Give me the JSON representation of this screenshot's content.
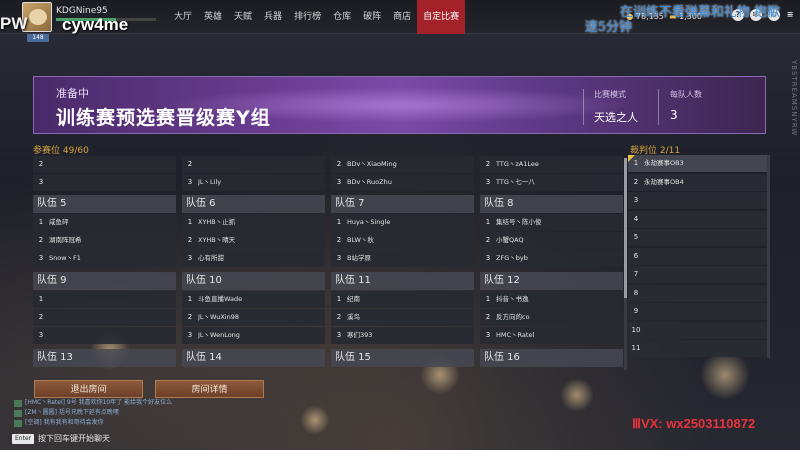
{
  "topbar": {
    "stream_label": "PW",
    "username": "KDGNine95",
    "streamer_name": "cyw4me",
    "level": "148",
    "nav": [
      "大厅",
      "英雄",
      "天赋",
      "兵器",
      "排行榜",
      "仓库",
      "破阵",
      "商店",
      "自定比赛"
    ],
    "active_nav": "自定比赛",
    "currency_1": "78,135",
    "currency_2": "1,300",
    "overlay_line1": "在训练不看弹幕和礼物 抱歉",
    "overlay_line2": "速5分钟",
    "side_watermark": "YBSTREAMSNYRW"
  },
  "banner": {
    "state": "准备中",
    "title": "训练赛预选赛晋级赛Y组",
    "mode_label": "比赛模式",
    "mode_value": "天选之人",
    "team_size_label": "每队人数",
    "team_size_value": "3"
  },
  "slots_label": "参赛位 49/60",
  "referee_label": "裁判位 2/11",
  "teams": [
    {
      "name": "",
      "partial": true,
      "slots": [
        {
          "n": "2",
          "player": ""
        },
        {
          "n": "3",
          "player": ""
        }
      ]
    },
    {
      "name": "",
      "partial": true,
      "slots": [
        {
          "n": "2",
          "player": ""
        },
        {
          "n": "3",
          "player": "JL丶Lily"
        }
      ]
    },
    {
      "name": "",
      "partial": true,
      "slots": [
        {
          "n": "2",
          "player": "BDv丶XiaoMing"
        },
        {
          "n": "3",
          "player": "BDv丶RuoZhu"
        }
      ]
    },
    {
      "name": "",
      "partial": true,
      "slots": [
        {
          "n": "2",
          "player": "TTG丶zA1Lee"
        },
        {
          "n": "3",
          "player": "TTG丶七一八"
        }
      ]
    },
    {
      "name": "队伍 5",
      "slots": [
        {
          "n": "1",
          "player": "咸鱼砰"
        },
        {
          "n": "2",
          "player": "湖南阵冠希"
        },
        {
          "n": "3",
          "player": "Snow丶F1"
        }
      ]
    },
    {
      "name": "队伍 6",
      "slots": [
        {
          "n": "1",
          "player": "XYHB丶止抓"
        },
        {
          "n": "2",
          "player": "XYHB丶晴天"
        },
        {
          "n": "3",
          "player": "心有所甜"
        }
      ]
    },
    {
      "name": "队伍 7",
      "slots": [
        {
          "n": "1",
          "player": "Huya丶Single"
        },
        {
          "n": "2",
          "player": "BLW丶秋"
        },
        {
          "n": "3",
          "player": "B站学原"
        }
      ]
    },
    {
      "name": "队伍 8",
      "slots": [
        {
          "n": "1",
          "player": "集结号丶陈小俊"
        },
        {
          "n": "2",
          "player": "小蟹QAQ"
        },
        {
          "n": "3",
          "player": "ZFG丶byb"
        }
      ]
    },
    {
      "name": "队伍 9",
      "slots": [
        {
          "n": "1",
          "player": ""
        },
        {
          "n": "2",
          "player": ""
        },
        {
          "n": "3",
          "player": ""
        }
      ]
    },
    {
      "name": "队伍 10",
      "slots": [
        {
          "n": "1",
          "player": "斗鱼直播Wade"
        },
        {
          "n": "2",
          "player": "JL丶WuXin98"
        },
        {
          "n": "3",
          "player": "JL丶WenLong"
        }
      ]
    },
    {
      "name": "队伍 11",
      "slots": [
        {
          "n": "1",
          "player": "纪南"
        },
        {
          "n": "2",
          "player": "溪鸟"
        },
        {
          "n": "3",
          "player": "寒们393"
        }
      ]
    },
    {
      "name": "队伍 12",
      "slots": [
        {
          "n": "1",
          "player": "抖音丶书逸"
        },
        {
          "n": "2",
          "player": "反方向的co"
        },
        {
          "n": "3",
          "player": "HMC丶Ratel"
        }
      ]
    },
    {
      "name": "队伍 13",
      "slots": []
    },
    {
      "name": "队伍 14",
      "slots": []
    },
    {
      "name": "队伍 15",
      "slots": []
    },
    {
      "name": "队伍 16",
      "slots": []
    }
  ],
  "referees": [
    {
      "n": "1",
      "name": "永劫赛事OB3"
    },
    {
      "n": "2",
      "name": "永劫赛事OB4"
    },
    {
      "n": "3",
      "name": ""
    },
    {
      "n": "4",
      "name": ""
    },
    {
      "n": "5",
      "name": ""
    },
    {
      "n": "6",
      "name": ""
    },
    {
      "n": "7",
      "name": ""
    },
    {
      "n": "8",
      "name": ""
    },
    {
      "n": "9",
      "name": ""
    },
    {
      "n": "10",
      "name": ""
    },
    {
      "n": "11",
      "name": ""
    }
  ],
  "buttons": {
    "leave_room": "退出房间",
    "room_details": "房间详情"
  },
  "chat": {
    "lines": [
      "[HMC丶Ratel] 9号 我喜欢你10年了 能给我个好友位么",
      "[ZM丶圆圆] 括号兄晚下延有点晚嘿",
      "[空调] 我有我有和哥待会发你"
    ],
    "enter_key": "Enter",
    "hint": "按下回车键开始聊天"
  },
  "watermark_contact": "ⅢVX:  wx2503110872",
  "colors": {
    "accent_red": "#a3222a",
    "label_gold": "#d9a640",
    "button_brown": "#8d5a3a",
    "banner_purple": "#6d3e94"
  }
}
